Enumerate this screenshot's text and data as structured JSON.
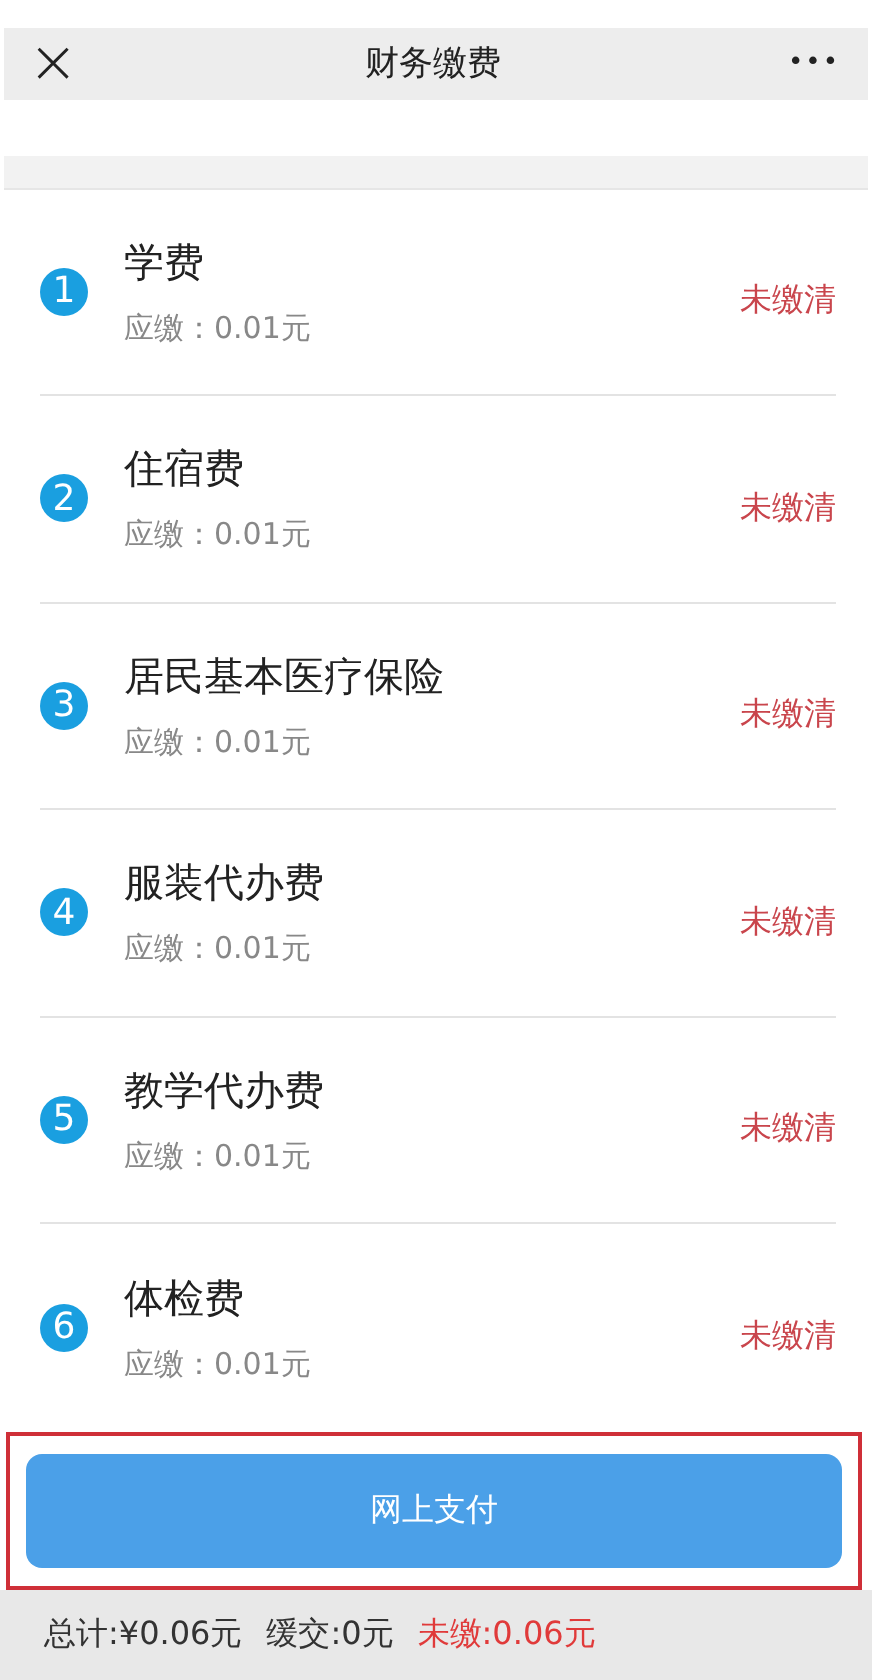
{
  "header": {
    "close": "×",
    "title": "财务缴费",
    "more": "•••"
  },
  "fees": [
    {
      "number": "1",
      "name": "学费",
      "due": "应缴：0.01元",
      "status": "未缴清"
    },
    {
      "number": "2",
      "name": "住宿费",
      "due": "应缴：0.01元",
      "status": "未缴清"
    },
    {
      "number": "3",
      "name": "居民基本医疗保险",
      "due": "应缴：0.01元",
      "status": "未缴清"
    },
    {
      "number": "4",
      "name": "服装代办费",
      "due": "应缴：0.01元",
      "status": "未缴清"
    },
    {
      "number": "5",
      "name": "教学代办费",
      "due": "应缴：0.01元",
      "status": "未缴清"
    },
    {
      "number": "6",
      "name": "体检费",
      "due": "应缴：0.01元",
      "status": "未缴清"
    }
  ],
  "pay_button": {
    "label": "网上支付",
    "highlighted": true
  },
  "summary": {
    "total": "总计:¥0.06元",
    "deferred": "缓交:0元",
    "unpaid": "未缴:0.06元"
  }
}
